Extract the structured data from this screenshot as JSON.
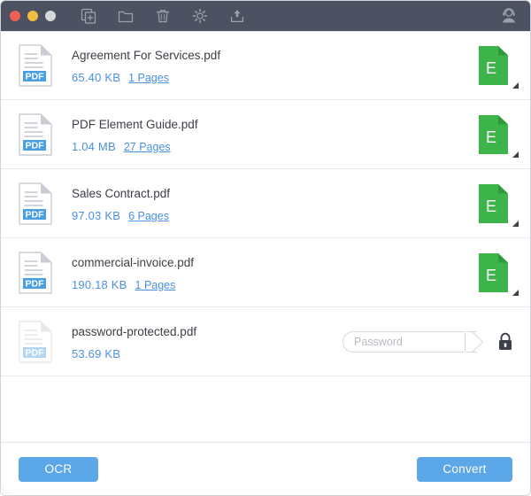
{
  "window": {
    "traffic_lights": [
      {
        "name": "close",
        "color": "#ee5f56"
      },
      {
        "name": "minimize",
        "color": "#f2bc40"
      },
      {
        "name": "zoom",
        "color": "#d6d8da"
      }
    ],
    "titlebar_color": "#4c5261"
  },
  "toolbar": {
    "items": [
      {
        "icon": "add-file-icon",
        "label": "Add File"
      },
      {
        "icon": "folder-icon",
        "label": "Add Folder"
      },
      {
        "icon": "trash-icon",
        "label": "Remove"
      },
      {
        "icon": "gear-icon",
        "label": "Settings"
      },
      {
        "icon": "upload-icon",
        "label": "Upload"
      }
    ],
    "support": {
      "icon": "support-agent-icon",
      "label": "Support"
    }
  },
  "files": [
    {
      "name": "Agreement For Services.pdf",
      "size": "65.40 KB",
      "pages": "1 Pages",
      "icon": "pdf-file-icon",
      "locked": false,
      "output": {
        "icon": "excel-file-icon",
        "letter": "E",
        "color": "#3cb44a"
      }
    },
    {
      "name": "PDF Element Guide.pdf",
      "size": "1.04 MB",
      "pages": "27 Pages",
      "icon": "pdf-file-icon",
      "locked": false,
      "output": {
        "icon": "excel-file-icon",
        "letter": "E",
        "color": "#3cb44a"
      }
    },
    {
      "name": "Sales Contract.pdf",
      "size": "97.03 KB",
      "pages": "6 Pages",
      "icon": "pdf-file-icon",
      "locked": false,
      "output": {
        "icon": "excel-file-icon",
        "letter": "E",
        "color": "#3cb44a"
      }
    },
    {
      "name": "commercial-invoice.pdf",
      "size": "190.18 KB",
      "pages": "1 Pages",
      "icon": "pdf-file-icon",
      "locked": false,
      "output": {
        "icon": "excel-file-icon",
        "letter": "E",
        "color": "#3cb44a"
      }
    },
    {
      "name": "password-protected.pdf",
      "size": "53.69 KB",
      "pages": "",
      "icon": "pdf-file-icon",
      "locked": true,
      "password": {
        "value": "",
        "placeholder": "Password",
        "lock_icon": "padlock-icon"
      }
    }
  ],
  "footer": {
    "ocr_label": "OCR",
    "convert_label": "Convert",
    "button_color": "#5ba7e8"
  },
  "colors": {
    "accent_blue": "#4a90e2",
    "green": "#3cb44a",
    "pdf_badge": "#4a9fe0",
    "titlebar": "#4c5261"
  }
}
